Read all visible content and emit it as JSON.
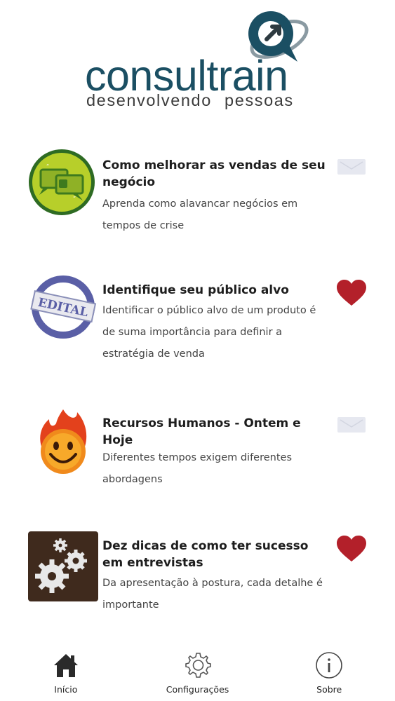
{
  "brand": {
    "name": "consultrain",
    "tagline": "desenvolvendo pessoas",
    "colors": {
      "primary": "#1b4f63",
      "dark": "#2d3a40"
    }
  },
  "articles": [
    {
      "title": "Como melhorar as vendas de seu negócio",
      "description": "Aprenda como alavancar negócios em tempos de crise",
      "thumbnail_icon": "chat-bubbles-icon",
      "favorite": false
    },
    {
      "title": "Identifique seu público alvo",
      "description": "Identificar o público alvo de um produto é de suma importância para definir a estratégia de venda",
      "thumbnail_icon": "edital-stamp-icon",
      "thumbnail_text": "EDITAL",
      "favorite": true
    },
    {
      "title": "Recursos Humanos - Ontem e Hoje",
      "description": "Diferentes tempos exigem diferentes abordagens",
      "thumbnail_icon": "fire-smiley-icon",
      "favorite": false
    },
    {
      "title": "Dez dicas de como ter sucesso em entrevistas",
      "description": "Da apresentação à postura, cada detalhe é importante",
      "thumbnail_icon": "gears-icon",
      "favorite": true
    }
  ],
  "icons": {
    "favorite_on": "heart-icon",
    "favorite_off": "envelope-icon",
    "favorite_on_color": "#b3202a",
    "favorite_off_color": "#e6e8f0"
  },
  "tabbar": {
    "tabs": [
      {
        "label": "Início",
        "icon": "home-icon",
        "active": true
      },
      {
        "label": "Configurações",
        "icon": "gear-icon",
        "active": false
      },
      {
        "label": "Sobre",
        "icon": "info-icon",
        "active": false
      }
    ]
  }
}
